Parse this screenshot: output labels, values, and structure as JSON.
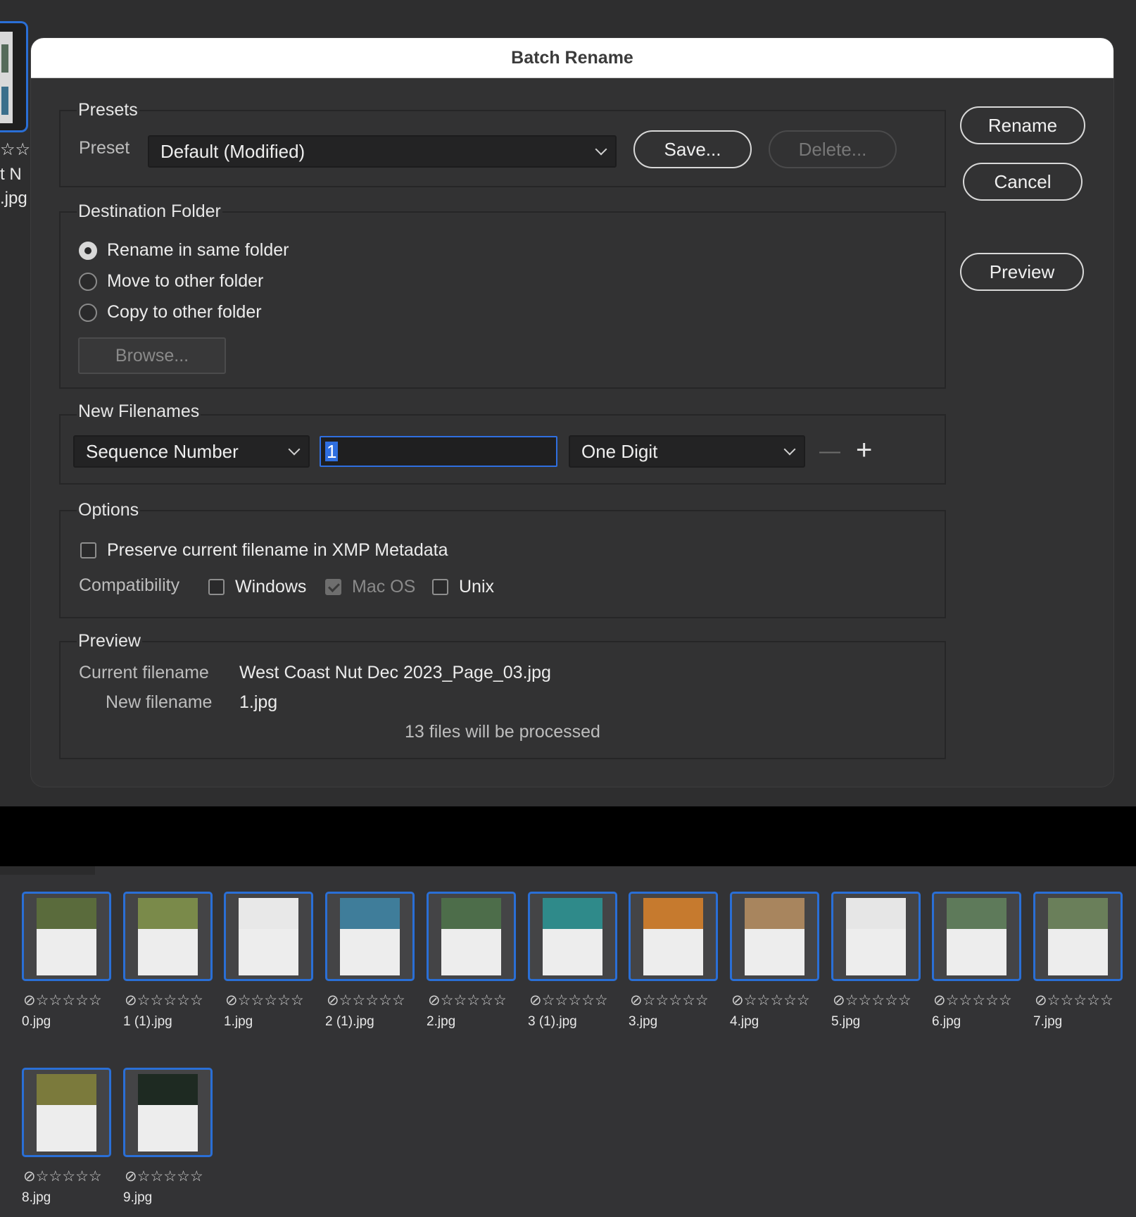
{
  "dialog": {
    "title": "Batch Rename",
    "presets": {
      "group_label": "Presets",
      "preset_label": "Preset",
      "preset_value": "Default (Modified)",
      "save_label": "Save...",
      "delete_label": "Delete..."
    },
    "buttons": {
      "rename": "Rename",
      "cancel": "Cancel",
      "preview": "Preview"
    },
    "destination": {
      "group_label": "Destination Folder",
      "options": [
        "Rename in same folder",
        "Move to other folder",
        "Copy to other folder"
      ],
      "selected": "Rename in same folder",
      "browse_label": "Browse..."
    },
    "new_filenames": {
      "group_label": "New Filenames",
      "type_value": "Sequence Number",
      "start_value": "1",
      "digits_value": "One Digit",
      "minus": "—",
      "plus": "+"
    },
    "options": {
      "group_label": "Options",
      "preserve_label": "Preserve current filename in XMP Metadata",
      "preserve_checked": false,
      "compat_label": "Compatibility",
      "windows_label": "Windows",
      "windows_checked": false,
      "macos_label": "Mac OS",
      "macos_checked": true,
      "unix_label": "Unix",
      "unix_checked": false
    },
    "preview": {
      "group_label": "Preview",
      "current_label": "Current filename",
      "current_value": "West Coast Nut Dec 2023_Page_03.jpg",
      "new_label": "New filename",
      "new_value": "1.jpg",
      "summary": "13 files will be processed"
    }
  },
  "background": {
    "peek_rating": "☆☆",
    "peek_line1": "t N",
    "peek_line2": ".jpg"
  },
  "thumbnails": [
    {
      "name": "0.jpg",
      "rating": "⃠☆☆☆☆☆",
      "art": "#5a6b3c"
    },
    {
      "name": "1 (1).jpg",
      "rating": "⃠☆☆☆☆☆",
      "art": "#7a8a4a"
    },
    {
      "name": "1.jpg",
      "rating": "⃠☆☆☆☆☆",
      "art": "#e8e8e8"
    },
    {
      "name": "2 (1).jpg",
      "rating": "⃠☆☆☆☆☆",
      "art": "#3f7d9a"
    },
    {
      "name": "2.jpg",
      "rating": "⃠☆☆☆☆☆",
      "art": "#4d6d4a"
    },
    {
      "name": "3 (1).jpg",
      "rating": "⃠☆☆☆☆☆",
      "art": "#2f8a8a"
    },
    {
      "name": "3.jpg",
      "rating": "⃠☆☆☆☆☆",
      "art": "#c67a2e"
    },
    {
      "name": "4.jpg",
      "rating": "⃠☆☆☆☆☆",
      "art": "#a8855e"
    },
    {
      "name": "5.jpg",
      "rating": "⃠☆☆☆☆☆",
      "art": "#e6e6e6"
    },
    {
      "name": "6.jpg",
      "rating": "⃠☆☆☆☆☆",
      "art": "#5e7a5a"
    },
    {
      "name": "7.jpg",
      "rating": "⃠☆☆☆☆☆",
      "art": "#6a7f5a"
    },
    {
      "name": "8.jpg",
      "rating": "⃠☆☆☆☆☆",
      "art": "#7b7a3c"
    },
    {
      "name": "9.jpg",
      "rating": "⃠☆☆☆☆☆",
      "art": "#1e2a22"
    }
  ],
  "colors": {
    "accent": "#2f6fe0",
    "dialog_bg": "#323233",
    "thumb_border": "#2a6fd6"
  }
}
